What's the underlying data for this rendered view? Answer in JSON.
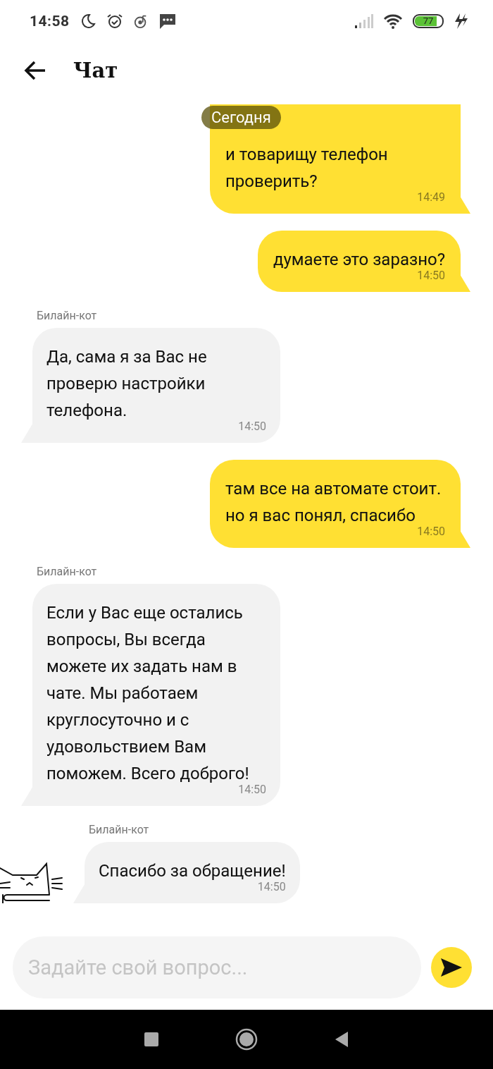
{
  "status_bar": {
    "time": "14:58",
    "battery": "77"
  },
  "header": {
    "title": "Чат"
  },
  "date_chip": "Сегодня",
  "messages": [
    {
      "kind": "outgoing",
      "text": "и товарищу телефон проверить?",
      "time": "14:49"
    },
    {
      "kind": "outgoing",
      "text": "думаете это заразно?",
      "time": "14:50"
    },
    {
      "kind": "incoming",
      "sender": "Билайн-кот",
      "text": "Да, сама я за Вас не проверю настройки телефона.",
      "time": "14:50"
    },
    {
      "kind": "outgoing",
      "text": "там все на автомате стоит. но я вас понял, спасибо",
      "time": "14:50"
    },
    {
      "kind": "incoming",
      "sender": "Билайн-кот",
      "text": "Если у Вас еще остались вопросы, Вы всегда можете их задать нам в чате. Мы работаем круглосуточно и с удовольствием Вам поможем. Всего доброго!",
      "time": "14:50"
    },
    {
      "kind": "incoming_avatar",
      "sender": "Билайн-кот",
      "text": "Спасибо за обращение!",
      "time": "14:50"
    }
  ],
  "composer": {
    "placeholder": "Задайте свой вопрос..."
  }
}
